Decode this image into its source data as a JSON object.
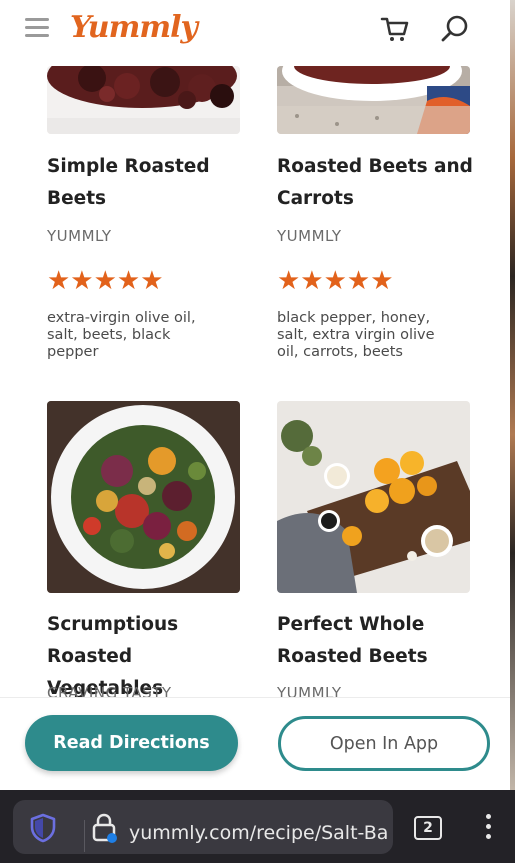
{
  "header": {
    "logo_text": "Yummly",
    "menu_icon": "hamburger-menu-icon",
    "cart_icon": "shopping-cart-icon",
    "search_icon": "search-icon",
    "brand_color": "#e1651f"
  },
  "cards": [
    {
      "title_line1": "Simple Roasted",
      "title_line2": "Beets",
      "source": "YUMMLY",
      "rating_stars": 5,
      "stars": "★★★★★",
      "ingredients": "extra-virgin olive oil, salt, beets, black pepper"
    },
    {
      "title_line1": "Roasted Beets and",
      "title_line2": "Carrots",
      "source": "YUMMLY",
      "rating_stars": 5,
      "stars": "★★★★★",
      "ingredients": "black pepper, honey, salt, extra virgin olive oil, carrots, beets"
    },
    {
      "title_line1": "Scrumptious Roasted",
      "title_line2": "Vegetables",
      "source": "CRAVING TASTY"
    },
    {
      "title_line1": "Perfect Whole",
      "title_line2": "Roasted Beets",
      "source": "YUMMLY"
    }
  ],
  "actions": {
    "read_directions": "Read Directions",
    "open_in_app": "Open In App",
    "accent_color": "#2e8b8c"
  },
  "browser": {
    "url": "yummly.com/recipe/Salt-Ba",
    "tab_count": "2",
    "shield_icon": "shield-icon",
    "lock_icon": "lock-icon",
    "menu_icon": "kebab-menu-icon"
  },
  "star_color": "#e2621b"
}
